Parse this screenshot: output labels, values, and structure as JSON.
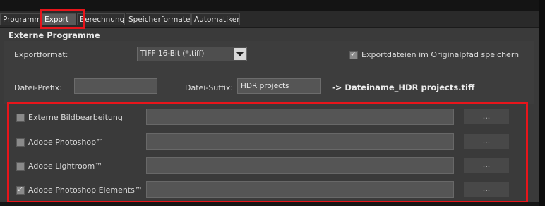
{
  "tabs": [
    {
      "label": "Programm"
    },
    {
      "label": "Export"
    },
    {
      "label": "Berechnung"
    },
    {
      "label": "Speicherformate"
    },
    {
      "label": "Automatiken"
    }
  ],
  "section": {
    "title": "Externe Programme"
  },
  "export": {
    "format_label": "Exportformat:",
    "format_value": "TIFF 16-Bit (*.tiff)",
    "save_original_label": "Exportdateien im Originalpfad speichern",
    "save_original_checked": true,
    "prefix_label": "Datei-Prefix:",
    "prefix_value": "",
    "suffix_label": "Datei-Suffix:",
    "suffix_value": "HDR projects",
    "result_text": "-> Dateiname_HDR projects.tiff"
  },
  "programs": [
    {
      "label": "Externe Bildbearbeitung",
      "checked": false,
      "path": "",
      "button": "..."
    },
    {
      "label": "Adobe Photoshop™",
      "checked": false,
      "path": "",
      "button": "..."
    },
    {
      "label": "Adobe Lightroom™",
      "checked": false,
      "path": "",
      "button": "..."
    },
    {
      "label": "Adobe Photoshop Elements™",
      "checked": true,
      "path": "",
      "button": "..."
    }
  ],
  "colors": {
    "highlight": "#e8151b",
    "panel": "#3a3a3a"
  }
}
